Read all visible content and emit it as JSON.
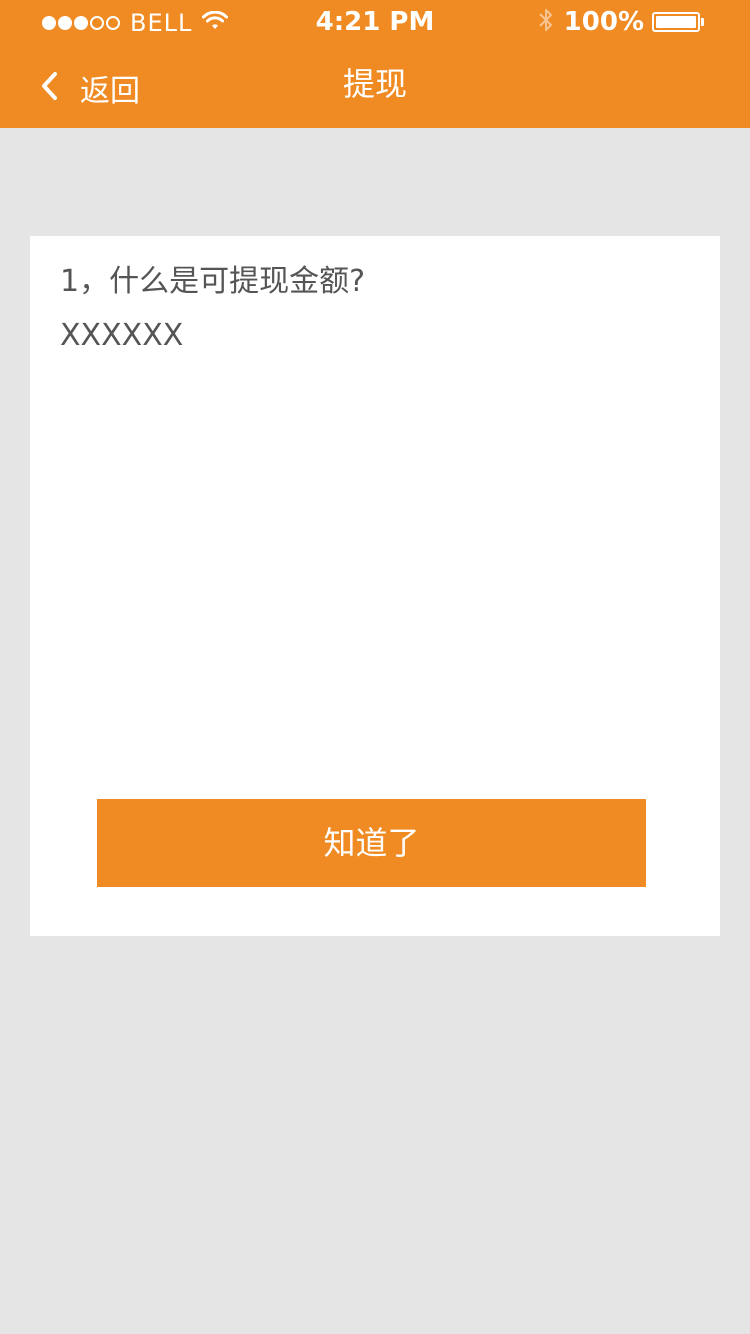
{
  "status_bar": {
    "carrier": "BELL",
    "time": "4:21 PM",
    "battery": "100%",
    "signal_bars_filled": 3,
    "signal_bars_total": 5
  },
  "nav": {
    "back_label": "返回",
    "title": "提现"
  },
  "content": {
    "question": "1，什么是可提现金额?",
    "answer": "XXXXXX"
  },
  "actions": {
    "ok_label": "知道了"
  },
  "colors": {
    "accent": "#f08a22",
    "background": "#e5e5e5",
    "card": "#ffffff",
    "text": "#555555"
  },
  "icons": {
    "back": "chevron-left-icon",
    "wifi": "wifi-icon",
    "bluetooth": "bluetooth-icon",
    "battery": "battery-icon"
  }
}
